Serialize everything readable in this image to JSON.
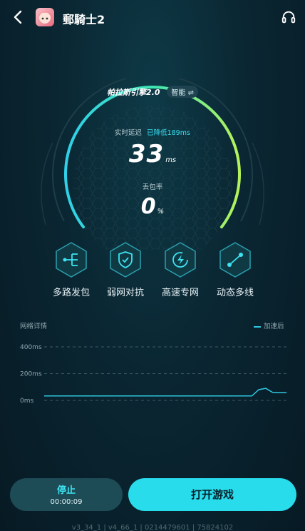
{
  "header": {
    "game_title": "郵騎士2"
  },
  "engine": {
    "brand": "帕拉斯引擎2.0",
    "mode": "智能 ⇌"
  },
  "status": {
    "realtime_label": "实时延迟",
    "drop_text": "已降低189ms",
    "ping_value": "33",
    "ping_unit": "ms",
    "loss_label": "丢包率",
    "loss_value": "0",
    "loss_unit": "%"
  },
  "features": [
    {
      "label": "多路发包",
      "icon": "multipath-icon"
    },
    {
      "label": "弱网对抗",
      "icon": "shield-check-icon"
    },
    {
      "label": "高速专网",
      "icon": "lightning-icon"
    },
    {
      "label": "动态多线",
      "icon": "route-icon"
    }
  ],
  "chart_data": {
    "type": "line",
    "title": "网络详情",
    "yticks": [
      "400ms",
      "200ms",
      "0ms"
    ],
    "ylim": [
      0,
      400
    ],
    "series": [
      {
        "name": "加速后",
        "values": [
          33,
          33,
          33,
          33,
          33,
          33,
          33,
          33,
          33,
          33,
          33,
          33,
          33,
          33,
          33,
          33,
          33,
          33,
          33,
          33,
          33,
          33,
          33,
          33,
          33,
          33,
          33,
          33,
          33,
          33,
          33,
          80,
          90,
          60,
          58,
          58
        ]
      }
    ],
    "colors": {
      "line": "#2ec8e0",
      "grid": "#3b5962"
    }
  },
  "actions": {
    "stop_label": "停止",
    "timer": "00:00:09",
    "open_label": "打开游戏"
  },
  "footer": {
    "version": "v3_34_1  |  v4_66_1  |  0214479601  |  75824102"
  }
}
